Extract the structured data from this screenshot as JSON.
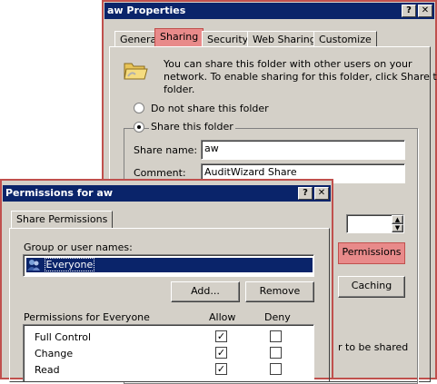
{
  "properties_window": {
    "title": "aw Properties",
    "help_btn": "?",
    "close_btn": "✕",
    "tabs": [
      {
        "label": "General"
      },
      {
        "label": "Sharing"
      },
      {
        "label": "Security"
      },
      {
        "label": "Web Sharing"
      },
      {
        "label": "Customize"
      }
    ],
    "info_text_1": "You can share this folder with other users on your",
    "info_text_2": "network.  To enable sharing for this folder, click Share this",
    "info_text_3": "folder.",
    "radio_not_share": "Do not share this folder",
    "radio_share": "Share this folder",
    "share_name_label": "Share name:",
    "share_name_value": "aw",
    "comment_label": "Comment:",
    "comment_value": "AuditWizard Share",
    "permissions_button": "Permissions",
    "caching_button": "Caching",
    "partial_text": "r to be shared"
  },
  "permissions_window": {
    "title": "Permissions for aw",
    "help_btn": "?",
    "close_btn": "✕",
    "tab_label": "Share Permissions",
    "group_label": "Group or user names:",
    "users": [
      {
        "name": "Everyone"
      }
    ],
    "add_button": "Add...",
    "remove_button": "Remove",
    "permissions_for": "Permissions for Everyone",
    "allow_header": "Allow",
    "deny_header": "Deny",
    "permissions": [
      {
        "name": "Full Control",
        "allow": true,
        "deny": false
      },
      {
        "name": "Change",
        "allow": true,
        "deny": false
      },
      {
        "name": "Read",
        "allow": true,
        "deny": false
      }
    ]
  },
  "colors": {
    "titlebar": "#0a246a",
    "highlight": "#e88a8a",
    "dialog": "#d4d0c8"
  }
}
